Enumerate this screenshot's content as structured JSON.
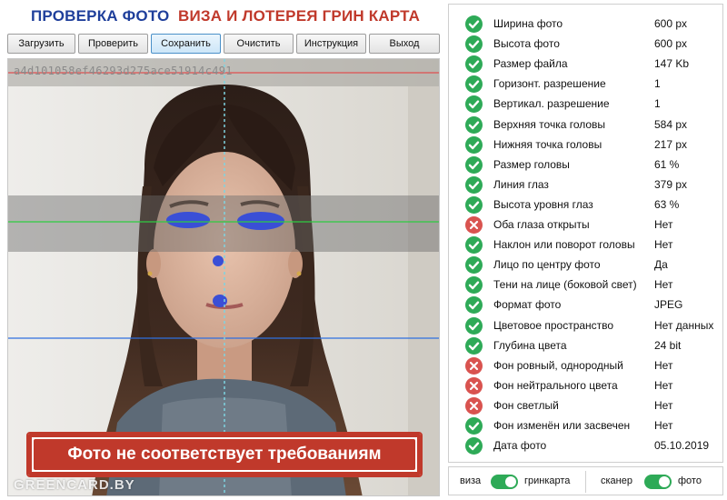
{
  "header": {
    "title_left": "ПРОВЕРКА ФОТО",
    "title_right": "ВИЗА И ЛОТЕРЕЯ ГРИН КАРТА"
  },
  "toolbar": {
    "load": "Загрузить",
    "check": "Проверить",
    "save": "Сохранить",
    "clear": "Очистить",
    "instructions": "Инструкция",
    "exit": "Выход"
  },
  "photo": {
    "hash": "a4d101058ef46293d275ace51914c491",
    "warning": "Фото не соответствует требованиям",
    "watermark": "GREENCARD.BY"
  },
  "checks": [
    {
      "label": "Ширина фото",
      "value": "600 px",
      "status": "ok"
    },
    {
      "label": "Высота фото",
      "value": "600 px",
      "status": "ok"
    },
    {
      "label": "Размер файла",
      "value": "147 Kb",
      "status": "ok"
    },
    {
      "label": "Горизонт. разрешение",
      "value": "1",
      "status": "ok"
    },
    {
      "label": "Вертикал. разрешение",
      "value": "1",
      "status": "ok"
    },
    {
      "label": "Верхняя точка головы",
      "value": "584 px",
      "status": "ok"
    },
    {
      "label": "Нижняя точка головы",
      "value": "217 px",
      "status": "ok"
    },
    {
      "label": "Размер головы",
      "value": "61 %",
      "status": "ok"
    },
    {
      "label": "Линия глаз",
      "value": "379 px",
      "status": "ok"
    },
    {
      "label": "Высота уровня глаз",
      "value": "63 %",
      "status": "ok"
    },
    {
      "label": "Оба глаза открыты",
      "value": "Нет",
      "status": "bad"
    },
    {
      "label": "Наклон или поворот головы",
      "value": "Нет",
      "status": "ok"
    },
    {
      "label": "Лицо по центру фото",
      "value": "Да",
      "status": "ok"
    },
    {
      "label": "Тени на лице (боковой свет)",
      "value": "Нет",
      "status": "ok"
    },
    {
      "label": "Формат фото",
      "value": "JPEG",
      "status": "ok"
    },
    {
      "label": "Цветовое пространство",
      "value": "Нет данных",
      "status": "ok"
    },
    {
      "label": "Глубина цвета",
      "value": "24 bit",
      "status": "ok"
    },
    {
      "label": "Фон ровный, однородный",
      "value": "Нет",
      "status": "bad"
    },
    {
      "label": "Фон нейтрального цвета",
      "value": "Нет",
      "status": "bad"
    },
    {
      "label": "Фон светлый",
      "value": "Нет",
      "status": "bad"
    },
    {
      "label": "Фон изменён или засвечен",
      "value": "Нет",
      "status": "ok"
    },
    {
      "label": "Дата фото",
      "value": "05.10.2019",
      "status": "ok"
    }
  ],
  "toggles": {
    "left_off": "виза",
    "left_on": "гринкарта",
    "right_off": "сканер",
    "right_on": "фото"
  },
  "colors": {
    "ok": "#2eaa57",
    "bad": "#d9534f",
    "title_blue": "#1f3f9b",
    "title_red": "#c0392b"
  }
}
